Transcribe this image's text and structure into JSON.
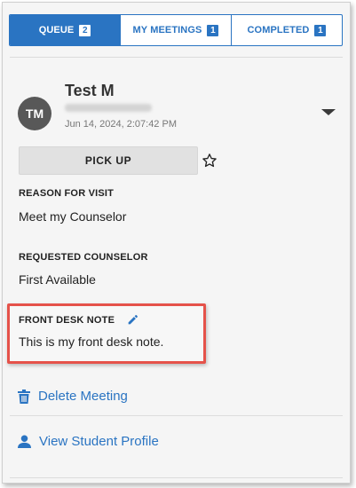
{
  "tabs": [
    {
      "label": "QUEUE",
      "count": "2"
    },
    {
      "label": "MY MEETINGS",
      "count": "1"
    },
    {
      "label": "COMPLETED",
      "count": "1"
    }
  ],
  "student": {
    "initials": "TM",
    "name": "Test M",
    "timestamp": "Jun 14, 2024, 2:07:42 PM"
  },
  "actions": {
    "pickup_label": "PICK UP",
    "delete_label": "Delete Meeting",
    "profile_label": "View Student Profile"
  },
  "sections": {
    "reason_label": "REASON FOR VISIT",
    "reason_value": "Meet my Counselor",
    "counselor_label": "REQUESTED COUNSELOR",
    "counselor_value": "First Available",
    "note_label": "FRONT DESK NOTE",
    "note_value": "This is my front desk note."
  },
  "colors": {
    "accent": "#2a74c2",
    "highlight": "#e5524a",
    "avatar": "#585858"
  }
}
